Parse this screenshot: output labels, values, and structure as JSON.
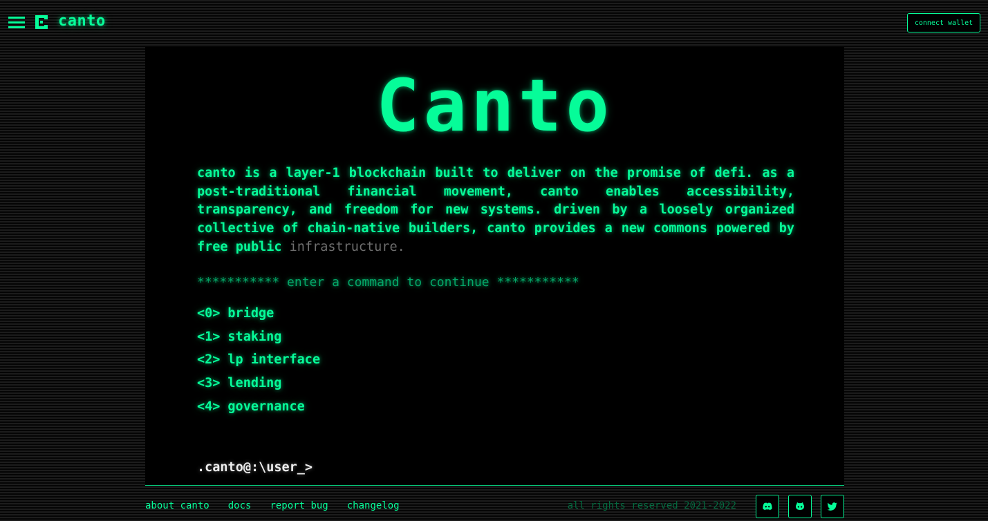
{
  "header": {
    "brand": "canto",
    "connect_label": "connect wallet"
  },
  "hero": {
    "title": "Canto"
  },
  "intro": {
    "text_main": "canto is a layer-1 blockchain built to deliver on the promise of defi. as a post-traditional financial movement, canto enables accessibility, transparency, and freedom for new systems. driven by a loosely organized collective of chain-native builders, canto provides a new commons powered by free public ",
    "text_dim": "infrastructure."
  },
  "prompt": "*********** enter a command to continue ***********",
  "menu": [
    {
      "key": "<0>",
      "label": "bridge"
    },
    {
      "key": "<1>",
      "label": "staking"
    },
    {
      "key": "<2>",
      "label": "lp interface"
    },
    {
      "key": "<3>",
      "label": "lending"
    },
    {
      "key": "<4>",
      "label": "governance"
    }
  ],
  "cli": ".canto@:\\user_>",
  "footer": {
    "links": [
      "about canto",
      "docs",
      "report bug",
      "changelog"
    ],
    "rights": "all rights reserved 2021-2022",
    "social_icons": [
      "discord-icon",
      "github-icon",
      "twitter-icon"
    ]
  },
  "colors": {
    "accent": "#06fc99",
    "dim_accent": "#04a768",
    "background": "#050505",
    "panel": "#000000"
  }
}
